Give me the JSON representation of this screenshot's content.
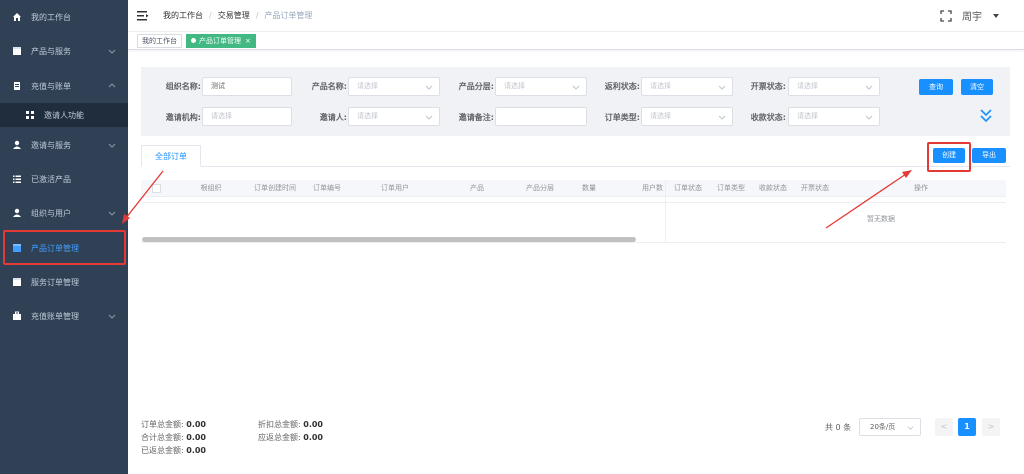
{
  "sidebar": {
    "items": [
      {
        "label": "我的工作台",
        "icon": "home-icon"
      },
      {
        "label": "产品与服务",
        "icon": "box-icon"
      },
      {
        "label": "充值与账单",
        "icon": "bill-icon"
      },
      {
        "label": "邀请人功能",
        "icon": "grid-icon"
      },
      {
        "label": "邀请与服务",
        "icon": "user-icon"
      },
      {
        "label": "已激活产品",
        "icon": "list-icon"
      },
      {
        "label": "组织与用户",
        "icon": "user-icon"
      },
      {
        "label": "产品订单管理",
        "icon": "box-icon"
      },
      {
        "label": "服务订单管理",
        "icon": "box-icon"
      },
      {
        "label": "充值账单管理",
        "icon": "briefcase-icon"
      }
    ]
  },
  "header": {
    "breadcrumb": [
      "我的工作台",
      "交易管理",
      "产品订单管理"
    ],
    "user": "周宇"
  },
  "tags": {
    "home": "我的工作台",
    "active": "产品订单管理",
    "close": "×"
  },
  "filters": {
    "org_name_label": "组织名称:",
    "org_name_value": "测试",
    "product_name_label": "产品名称:",
    "product_tier_label": "产品分层:",
    "rebate_status_label": "返利状态:",
    "invoice_status_label": "开票状态:",
    "invite_org_label": "邀请机构:",
    "inviter_label": "邀请人:",
    "invite_note_label": "邀请备注:",
    "order_type_label": "订单类型:",
    "payment_status_label": "收款状态:",
    "placeholder": "请选择",
    "search_label": "查询",
    "clear_label": "清空"
  },
  "tabs": {
    "all_orders": "全部订单"
  },
  "actions": {
    "create_label": "创建",
    "export_label": "导出"
  },
  "table": {
    "columns": [
      "根组织",
      "订单创建时间",
      "订单编号",
      "订单用户",
      "产品",
      "产品分层",
      "数量",
      "用户数",
      "订单状态",
      "订单类型",
      "收款状态",
      "开票状态",
      "操作"
    ],
    "empty_text": "暂无数据"
  },
  "summary": {
    "order_total_label": "订单总金额:",
    "order_total_value": "0.00",
    "combined_total_label": "合计总金额:",
    "combined_total_value": "0.00",
    "rebated_total_label": "已返总金额:",
    "rebated_total_value": "0.00",
    "discount_total_label": "折扣总金额:",
    "discount_total_value": "0.00",
    "due_rebate_label": "应返总金额:",
    "due_rebate_value": "0.00"
  },
  "pagination": {
    "total": "共 0 条",
    "page_size": "20条/页",
    "prev": "<",
    "current": "1",
    "next": ">"
  },
  "colors": {
    "sidebar_bg": "#304156",
    "primary": "#1890ff",
    "active_tag": "#42b983",
    "annotation": "#e53935"
  }
}
